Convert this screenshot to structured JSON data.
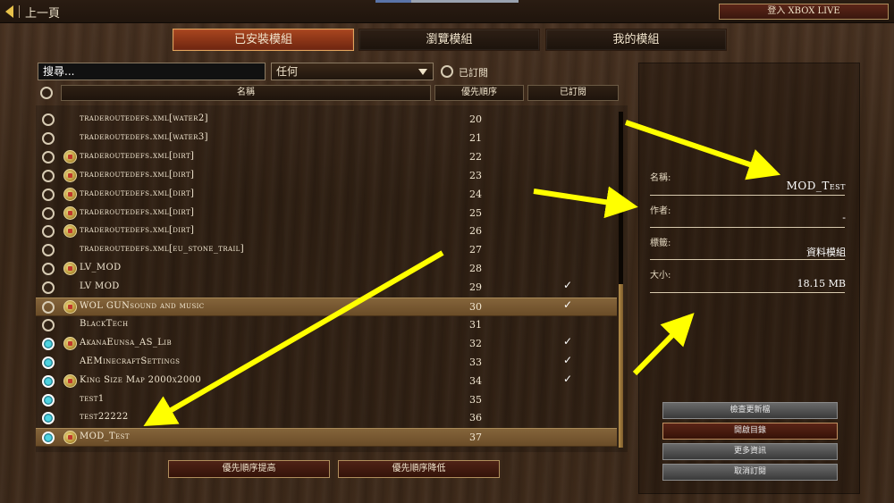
{
  "topbar": {
    "back_label": "上一頁",
    "xbox_label": "登入 XBOX LIVE"
  },
  "tabs": [
    {
      "label": "已安裝模組",
      "active": true
    },
    {
      "label": "瀏覽模組",
      "active": false
    },
    {
      "label": "我的模組",
      "active": false
    }
  ],
  "search": {
    "placeholder": "搜尋..."
  },
  "filter": {
    "selected": "任何"
  },
  "subscribed_filter_label": "已訂閱",
  "columns": {
    "name": "名稱",
    "priority": "優先順序",
    "subscribed": "已訂閱"
  },
  "mods": [
    {
      "name": "traderoutedefs.xml[water2]",
      "priority": "20",
      "icon": false,
      "checked": false,
      "subscribed": false
    },
    {
      "name": "traderoutedefs.xml[water3]",
      "priority": "21",
      "icon": false,
      "checked": false,
      "subscribed": false
    },
    {
      "name": "traderoutedefs.xml[dirt]",
      "priority": "22",
      "icon": true,
      "checked": false,
      "subscribed": false
    },
    {
      "name": "traderoutedefs.xml[dirt]",
      "priority": "23",
      "icon": true,
      "checked": false,
      "subscribed": false
    },
    {
      "name": "traderoutedefs.xml[dirt]",
      "priority": "24",
      "icon": true,
      "checked": false,
      "subscribed": false
    },
    {
      "name": "traderoutedefs.xml[dirt]",
      "priority": "25",
      "icon": true,
      "checked": false,
      "subscribed": false
    },
    {
      "name": "traderoutedefs.xml[dirt]",
      "priority": "26",
      "icon": true,
      "checked": false,
      "subscribed": false
    },
    {
      "name": "traderoutedefs.xml[eu_stone_trail]",
      "priority": "27",
      "icon": false,
      "checked": false,
      "subscribed": false
    },
    {
      "name": "LV_MOD",
      "priority": "28",
      "icon": true,
      "checked": false,
      "subscribed": false
    },
    {
      "name": "LV MOD",
      "priority": "29",
      "icon": false,
      "checked": false,
      "subscribed": true
    },
    {
      "name": "WOL GUNsound and music",
      "priority": "30",
      "icon": true,
      "checked": false,
      "subscribed": true,
      "highlight": true
    },
    {
      "name": "BlackTech",
      "priority": "31",
      "icon": false,
      "checked": false,
      "subscribed": false
    },
    {
      "name": "AkanaEunsa_AS_Lib",
      "priority": "32",
      "icon": true,
      "checked": true,
      "subscribed": true
    },
    {
      "name": "AEMinecraftSettings",
      "priority": "33",
      "icon": false,
      "checked": true,
      "subscribed": true
    },
    {
      "name": "King Size Map 2000x2000",
      "priority": "34",
      "icon": true,
      "checked": true,
      "subscribed": true
    },
    {
      "name": "test1",
      "priority": "35",
      "icon": false,
      "checked": true,
      "subscribed": false
    },
    {
      "name": "test22222",
      "priority": "36",
      "icon": false,
      "checked": true,
      "subscribed": false
    },
    {
      "name": "MOD_Test",
      "priority": "37",
      "icon": true,
      "checked": true,
      "subscribed": false,
      "highlight": true
    }
  ],
  "checkmark": "✓",
  "buttons": {
    "priority_up": "優先順序提高",
    "priority_down": "優先順序降低"
  },
  "details": {
    "name_label": "名稱:",
    "name_value": "MOD_Test",
    "author_label": "作者:",
    "author_value": "-",
    "tags_label": "標籤:",
    "tags_value": "資料模組",
    "size_label": "大小:",
    "size_value": "18.15 MB"
  },
  "actions": {
    "check_updates": "檢查更新檔",
    "open_folder": "開啟目錄",
    "more_info": "更多資訊",
    "unsubscribe": "取消訂閱"
  },
  "colors": {
    "arrow": "#ffff00",
    "active_tab": "#a9461f",
    "radio_on": "#4fd3e0"
  }
}
